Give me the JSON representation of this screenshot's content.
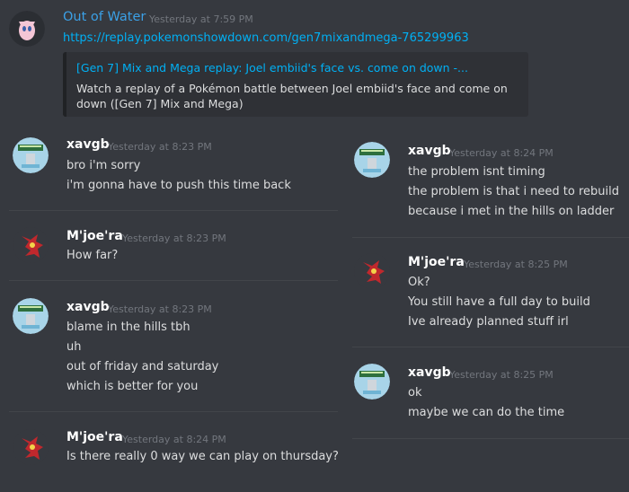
{
  "top_message": {
    "author": "Out of Water",
    "timestamp": "Yesterday at 7:59 PM",
    "link": "https://replay.pokemonshowdown.com/gen7mixandmega-765299963",
    "embed": {
      "title": "[Gen 7] Mix and Mega replay: Joel embiid's face vs. come on down -...",
      "description": "Watch a replay of a Pokémon battle between Joel embiid's face and come on down ([Gen 7] Mix and Mega)"
    }
  },
  "left_column": [
    {
      "author": "xavgb",
      "timestamp": "Yesterday at 8:23 PM",
      "lines": [
        "bro i'm sorry",
        "i'm gonna have to push this time back"
      ]
    },
    {
      "author": "M'joe'ra",
      "timestamp": "Yesterday at 8:23 PM",
      "lines": [
        "How far?"
      ]
    },
    {
      "author": "xavgb",
      "timestamp": "Yesterday at 8:23 PM",
      "lines": [
        "blame in the hills tbh",
        "uh",
        "out of friday and saturday",
        "which is better for you"
      ]
    },
    {
      "author": "M'joe'ra",
      "timestamp": "Yesterday at 8:24 PM",
      "lines": [
        "Is there really 0 way we can play on thursday?"
      ]
    }
  ],
  "right_column": [
    {
      "author": "xavgb",
      "timestamp": "Yesterday at 8:24 PM",
      "lines": [
        "the problem isnt timing",
        "the problem is that i need to rebuild",
        "because i met in the hills on ladder"
      ]
    },
    {
      "author": "M'joe'ra",
      "timestamp": "Yesterday at 8:25 PM",
      "lines": [
        "Ok?",
        "You still have a full day to build",
        "Ive already planned stuff irl"
      ]
    },
    {
      "author": "xavgb",
      "timestamp": "Yesterday at 8:25 PM",
      "lines": [
        "ok",
        "maybe we can do the time"
      ]
    }
  ],
  "colors": {
    "background": "#36393f",
    "link": "#00b0f4",
    "embed_bg": "#2f3136",
    "username": "#ffffff",
    "top_username": "#3ba0e6",
    "timestamp": "#72767d"
  },
  "icons": {
    "avatar_out_of_water": "mew-avatar",
    "avatar_xavgb": "pixel-sprite-avatar",
    "avatar_mjoera": "red-creature-avatar"
  }
}
